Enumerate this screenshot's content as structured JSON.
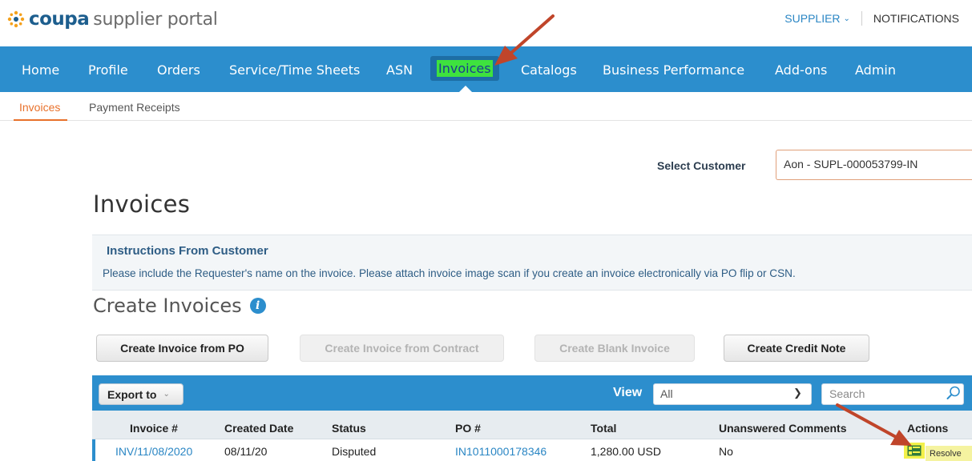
{
  "header": {
    "brand": "coupa",
    "brand_suffix": "supplier portal",
    "supplier_menu": "SUPPLIER",
    "notifications": "NOTIFICATIONS"
  },
  "nav": {
    "items": [
      "Home",
      "Profile",
      "Orders",
      "Service/Time Sheets",
      "ASN",
      "Invoices",
      "Catalogs",
      "Business Performance",
      "Add-ons",
      "Admin"
    ],
    "active": "Invoices"
  },
  "subnav": {
    "items": [
      "Invoices",
      "Payment Receipts"
    ],
    "active": "Invoices"
  },
  "customer": {
    "label": "Select Customer",
    "value": "Aon - SUPL-000053799-IN"
  },
  "page": {
    "title": "Invoices"
  },
  "instructions": {
    "title": "Instructions From Customer",
    "text": "Please include the Requester's name on the invoice. Please attach invoice image scan if you create an invoice electronically via PO flip or CSN."
  },
  "create": {
    "title": "Create Invoices",
    "buttons": [
      {
        "label": "Create Invoice from PO",
        "enabled": true
      },
      {
        "label": "Create Invoice from Contract",
        "enabled": false
      },
      {
        "label": "Create Blank Invoice",
        "enabled": false
      },
      {
        "label": "Create Credit Note",
        "enabled": true
      }
    ]
  },
  "table_toolbar": {
    "export_label": "Export to",
    "view_label": "View",
    "view_value": "All",
    "search_placeholder": "Search"
  },
  "table": {
    "columns": [
      "Invoice #",
      "Created Date",
      "Status",
      "PO #",
      "Total",
      "Unanswered Comments",
      "Actions"
    ],
    "rows": [
      {
        "invoice": "INV/11/08/2020",
        "created": "08/11/20",
        "status": "Disputed",
        "po": "IN1011000178346",
        "total": "1,280.00 USD",
        "comments": "No",
        "action": "Resolve"
      }
    ]
  },
  "colors": {
    "nav_blue": "#2c8ecd",
    "accent_orange": "#e8712b",
    "highlight_green": "#3ee23e",
    "highlight_yellow": "#f3f14a",
    "arrow_red": "#c0452a"
  }
}
